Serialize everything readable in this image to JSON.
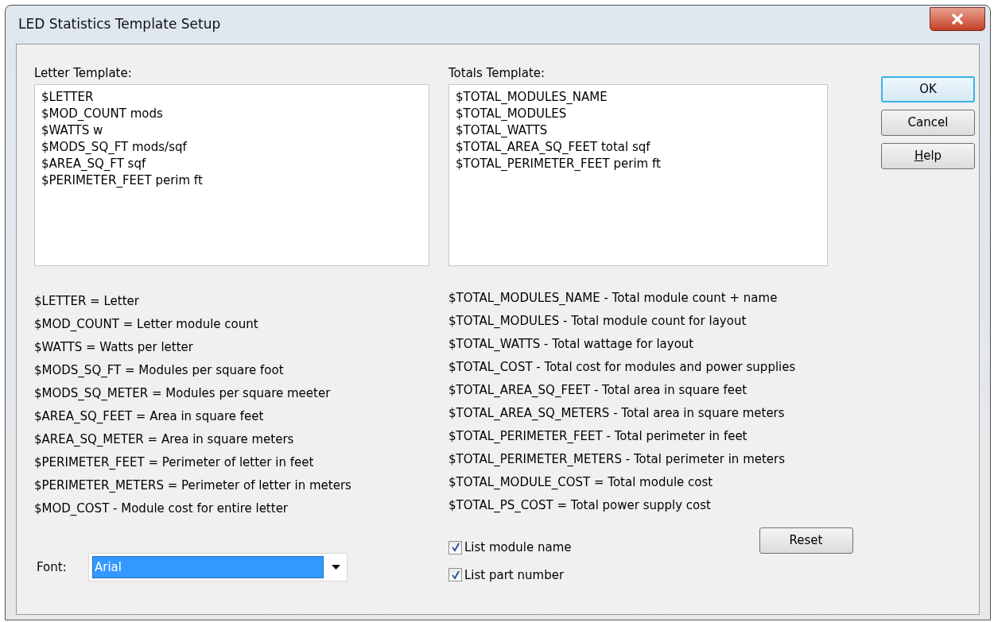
{
  "window": {
    "title": "LED Statistics Template Setup"
  },
  "letter_template": {
    "label": "Letter Template:",
    "lines": [
      "$LETTER",
      "$MOD_COUNT mods",
      "$WATTS w",
      "$MODS_SQ_FT mods/sqf",
      "$AREA_SQ_FT sqf",
      "$PERIMETER_FEET perim ft"
    ]
  },
  "totals_template": {
    "label": "Totals Template:",
    "lines": [
      "$TOTAL_MODULES_NAME",
      "$TOTAL_MODULES",
      "$TOTAL_WATTS",
      "$TOTAL_AREA_SQ_FEET total sqf",
      "$TOTAL_PERIMETER_FEET perim ft"
    ]
  },
  "buttons": [
    {
      "label": "OK",
      "default": true,
      "mnemonic_underlined": false
    },
    {
      "label": "Cancel",
      "default": false,
      "mnemonic_underlined": false
    },
    {
      "label": "Help",
      "default": false,
      "mnemonic_underlined": true
    }
  ],
  "letter_legend": [
    "$LETTER = Letter",
    "$MOD_COUNT = Letter module count",
    "$WATTS = Watts per letter",
    "$MODS_SQ_FT = Modules per square foot",
    "$MODS_SQ_METER = Modules per square meeter",
    "$AREA_SQ_FEET = Area in square feet",
    "$AREA_SQ_METER = Area in square meters",
    "$PERIMETER_FEET = Perimeter of letter in feet",
    "$PERIMETER_METERS = Perimeter of letter in meters",
    "$MOD_COST - Module cost for entire letter"
  ],
  "totals_legend": [
    "$TOTAL_MODULES_NAME - Total module count + name",
    "$TOTAL_MODULES - Total module count for layout",
    "$TOTAL_WATTS - Total wattage for layout",
    "$TOTAL_COST - Total cost for modules and power supplies",
    "$TOTAL_AREA_SQ_FEET - Total area in square feet",
    "$TOTAL_AREA_SQ_METERS - Total area in square meters",
    "$TOTAL_PERIMETER_FEET - Total perimeter in feet",
    "$TOTAL_PERIMETER_METERS - Total perimeter in meters",
    "$TOTAL_MODULE_COST = Total module cost",
    "$TOTAL_PS_COST = Total power supply cost"
  ],
  "font": {
    "label": "Font:",
    "value": "Arial",
    "text_selected": true
  },
  "checkboxes": [
    {
      "label": "List module name",
      "checked": true
    },
    {
      "label": "List part number",
      "checked": true
    }
  ],
  "reset_button": {
    "label": "Reset"
  }
}
